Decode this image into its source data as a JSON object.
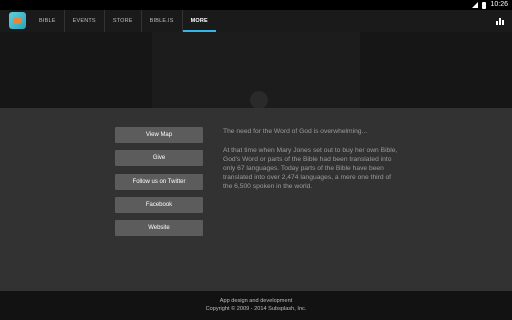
{
  "status": {
    "time": "10:26"
  },
  "tabs": [
    {
      "label": "BIBLE"
    },
    {
      "label": "EVENTS"
    },
    {
      "label": "STORE"
    },
    {
      "label": "BIBLE.IS"
    },
    {
      "label": "MORE",
      "active": true
    }
  ],
  "buttons": {
    "view_map": "View Map",
    "give": "Give",
    "twitter": "Follow us on Twitter",
    "facebook": "Facebook",
    "website": "Website"
  },
  "intro": {
    "headline": "The need for the Word of God is overwhelming...",
    "body": "At that time when Mary Jones set out to buy her own Bible, God's Word or parts of the Bible had been translated into only 67 languages. Today parts of the Bible have been translated into over 2,474 languages, a mere one third of the 6,500 spoken in the world."
  },
  "footer": {
    "line1": "App design and development",
    "line2": "Copyright © 2009 - 2014 Subsplash, Inc."
  },
  "colors": {
    "accent": "#33b5e5",
    "button": "#5c5c5c"
  }
}
